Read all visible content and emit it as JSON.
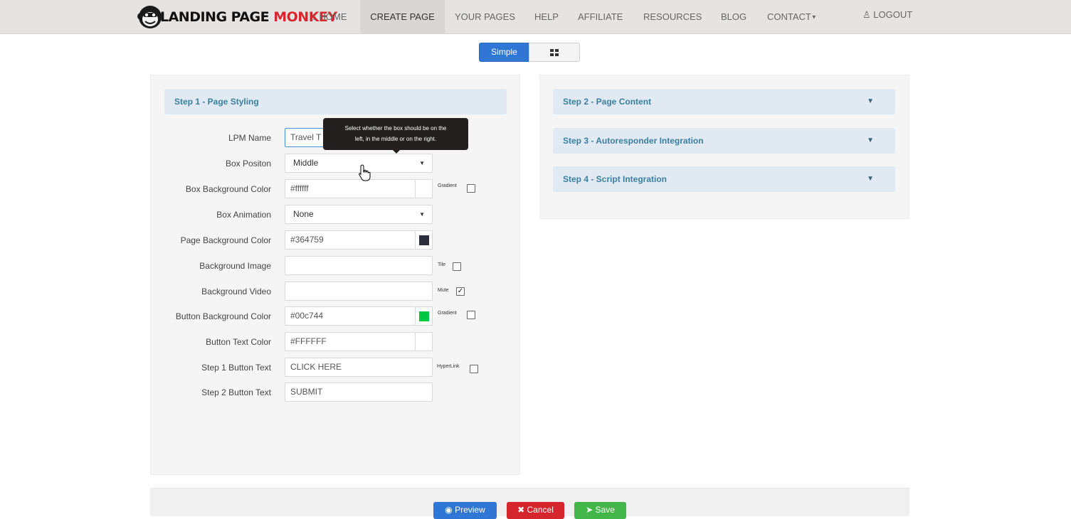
{
  "brand": {
    "name_part1": "LANDING PAGE",
    "name_part2": "MONKEY"
  },
  "nav": {
    "home": "HOME",
    "create": "CREATE PAGE",
    "your_pages": "YOUR PAGES",
    "help": "HELP",
    "affiliate": "AFFILIATE",
    "resources": "RESOURCES",
    "blog": "BLOG",
    "contact": "CONTACT",
    "logout": "LOGOUT"
  },
  "mode_toggle": {
    "simple": "Simple",
    "grid_icon": "grid-icon"
  },
  "steps": {
    "step1": "Step 1 - Page Styling",
    "step2": "Step 2 - Page Content",
    "step3": "Step 3 - Autoresponder Integration",
    "step4": "Step 4 - Script Integration"
  },
  "form": {
    "lpm_name": {
      "label": "LPM Name",
      "value": "Travel T"
    },
    "box_position": {
      "label": "Box Positon",
      "value": "Middle"
    },
    "box_bg_color": {
      "label": "Box Background Color",
      "value": "#ffffff",
      "color": "#ffffff",
      "option": "Gradient"
    },
    "box_animation": {
      "label": "Box Animation",
      "value": "None"
    },
    "page_bg_color": {
      "label": "Page Background Color",
      "value": "#364759",
      "color": "#2a2d3a"
    },
    "bg_image": {
      "label": "Background Image",
      "value": "",
      "option": "Tile"
    },
    "bg_video": {
      "label": "Background Video",
      "value": "",
      "option": "Mute",
      "checked": true
    },
    "btn_bg_color": {
      "label": "Button Background Color",
      "value": "#00c744",
      "color": "#00c744",
      "option": "Gradient"
    },
    "btn_text_color": {
      "label": "Button Text Color",
      "value": "#FFFFFF",
      "color": "#ffffff"
    },
    "step1_btn_text": {
      "label": "Step 1 Button Text",
      "value": "CLICK HERE",
      "option": "HyperLink"
    },
    "step2_btn_text": {
      "label": "Step 2 Button Text",
      "value": "SUBMIT"
    }
  },
  "tooltip": {
    "line1": "Select whether the box should be on the",
    "line2": "left, in the middle or on the right."
  },
  "footer": {
    "preview": "Preview",
    "cancel": "Cancel",
    "save": "Save"
  },
  "colors": {
    "primary": "#2f76d5",
    "danger": "#d6262d",
    "success": "#43b649",
    "step_header_bg": "#e1eaf2",
    "step_header_text": "#3b7fa0"
  }
}
